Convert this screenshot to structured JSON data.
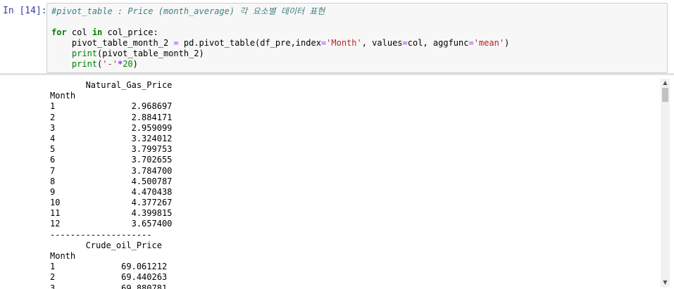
{
  "cell": {
    "prompt": "In [14]:",
    "code_lines": [
      [
        {
          "t": "#pivot_table : Price (month_average) 각 요소별 데이터 표현",
          "c": "comment"
        }
      ],
      [
        {
          "t": "",
          "c": ""
        }
      ],
      [
        {
          "t": "for",
          "c": "keyword"
        },
        {
          "t": " col ",
          "c": ""
        },
        {
          "t": "in",
          "c": "keyword"
        },
        {
          "t": " col_price:",
          "c": ""
        }
      ],
      [
        {
          "t": "    pivot_table_month_2 ",
          "c": ""
        },
        {
          "t": "=",
          "c": "operator"
        },
        {
          "t": " pd.pivot_table(df_pre,index",
          "c": ""
        },
        {
          "t": "=",
          "c": "operator"
        },
        {
          "t": "'Month'",
          "c": "string"
        },
        {
          "t": ", values",
          "c": ""
        },
        {
          "t": "=",
          "c": "operator"
        },
        {
          "t": "col, aggfunc",
          "c": ""
        },
        {
          "t": "=",
          "c": "operator"
        },
        {
          "t": "'mean'",
          "c": "string"
        },
        {
          "t": ")",
          "c": ""
        }
      ],
      [
        {
          "t": "    ",
          "c": ""
        },
        {
          "t": "print",
          "c": "builtin"
        },
        {
          "t": "(pivot_table_month_2)",
          "c": ""
        }
      ],
      [
        {
          "t": "    ",
          "c": ""
        },
        {
          "t": "print",
          "c": "builtin"
        },
        {
          "t": "(",
          "c": ""
        },
        {
          "t": "'-'",
          "c": "string"
        },
        {
          "t": "*",
          "c": "op"
        },
        {
          "t": "20",
          "c": "number"
        },
        {
          "t": ")",
          "c": ""
        }
      ]
    ]
  },
  "output": {
    "lines": [
      "       Natural_Gas_Price",
      "Month",
      "1               2.968697",
      "2               2.884171",
      "3               2.959099",
      "4               3.324012",
      "5               3.799753",
      "6               3.702655",
      "7               3.784700",
      "8               4.500787",
      "9               4.470438",
      "10              4.377267",
      "11              4.399815",
      "12              3.657400",
      "--------------------",
      "       Crude_oil_Price",
      "Month",
      "1             69.061212",
      "2             69.440263",
      "3             69.880781"
    ]
  },
  "scrollbar": {
    "up_icon": "▲",
    "down_icon": "▼"
  }
}
